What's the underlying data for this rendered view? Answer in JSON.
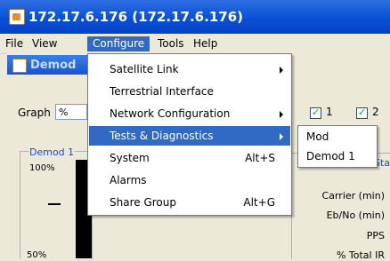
{
  "window": {
    "title": "172.17.6.176 (172.17.6.176)"
  },
  "menubar": {
    "items": [
      "File",
      "View",
      "Configure",
      "Tools",
      "Help"
    ]
  },
  "inner_frame": {
    "title": "Demod"
  },
  "graph": {
    "label": "Graph",
    "combo_value": "%"
  },
  "checkboxes": [
    {
      "label": "1",
      "checked": true
    },
    {
      "label": "2",
      "checked": true
    }
  ],
  "demod_panel": {
    "title": "Demod 1",
    "y_top": "100%",
    "y_mid": "50%"
  },
  "stats_panel": {
    "title": "Sta",
    "rows": [
      "Carrier (min)",
      "Eb/No (min)",
      "PPS",
      "% Total IR"
    ]
  },
  "configure_menu": {
    "items": [
      {
        "label": "Satellite Link",
        "submenu": true
      },
      {
        "label": "Terrestrial Interface"
      },
      {
        "label": "Network Configuration",
        "submenu": true
      },
      {
        "label": "Tests & Diagnostics",
        "submenu": true,
        "highlighted": true
      },
      {
        "label": "System",
        "shortcut": "Alt+S"
      },
      {
        "label": "Alarms"
      },
      {
        "label": "Share Group",
        "shortcut": "Alt+G"
      }
    ]
  },
  "submenu": {
    "items": [
      "Mod",
      "Demod 1"
    ]
  },
  "colors": {
    "title_bar": "#0a4fd8",
    "highlight": "#316ac5",
    "check": "#21a121"
  }
}
